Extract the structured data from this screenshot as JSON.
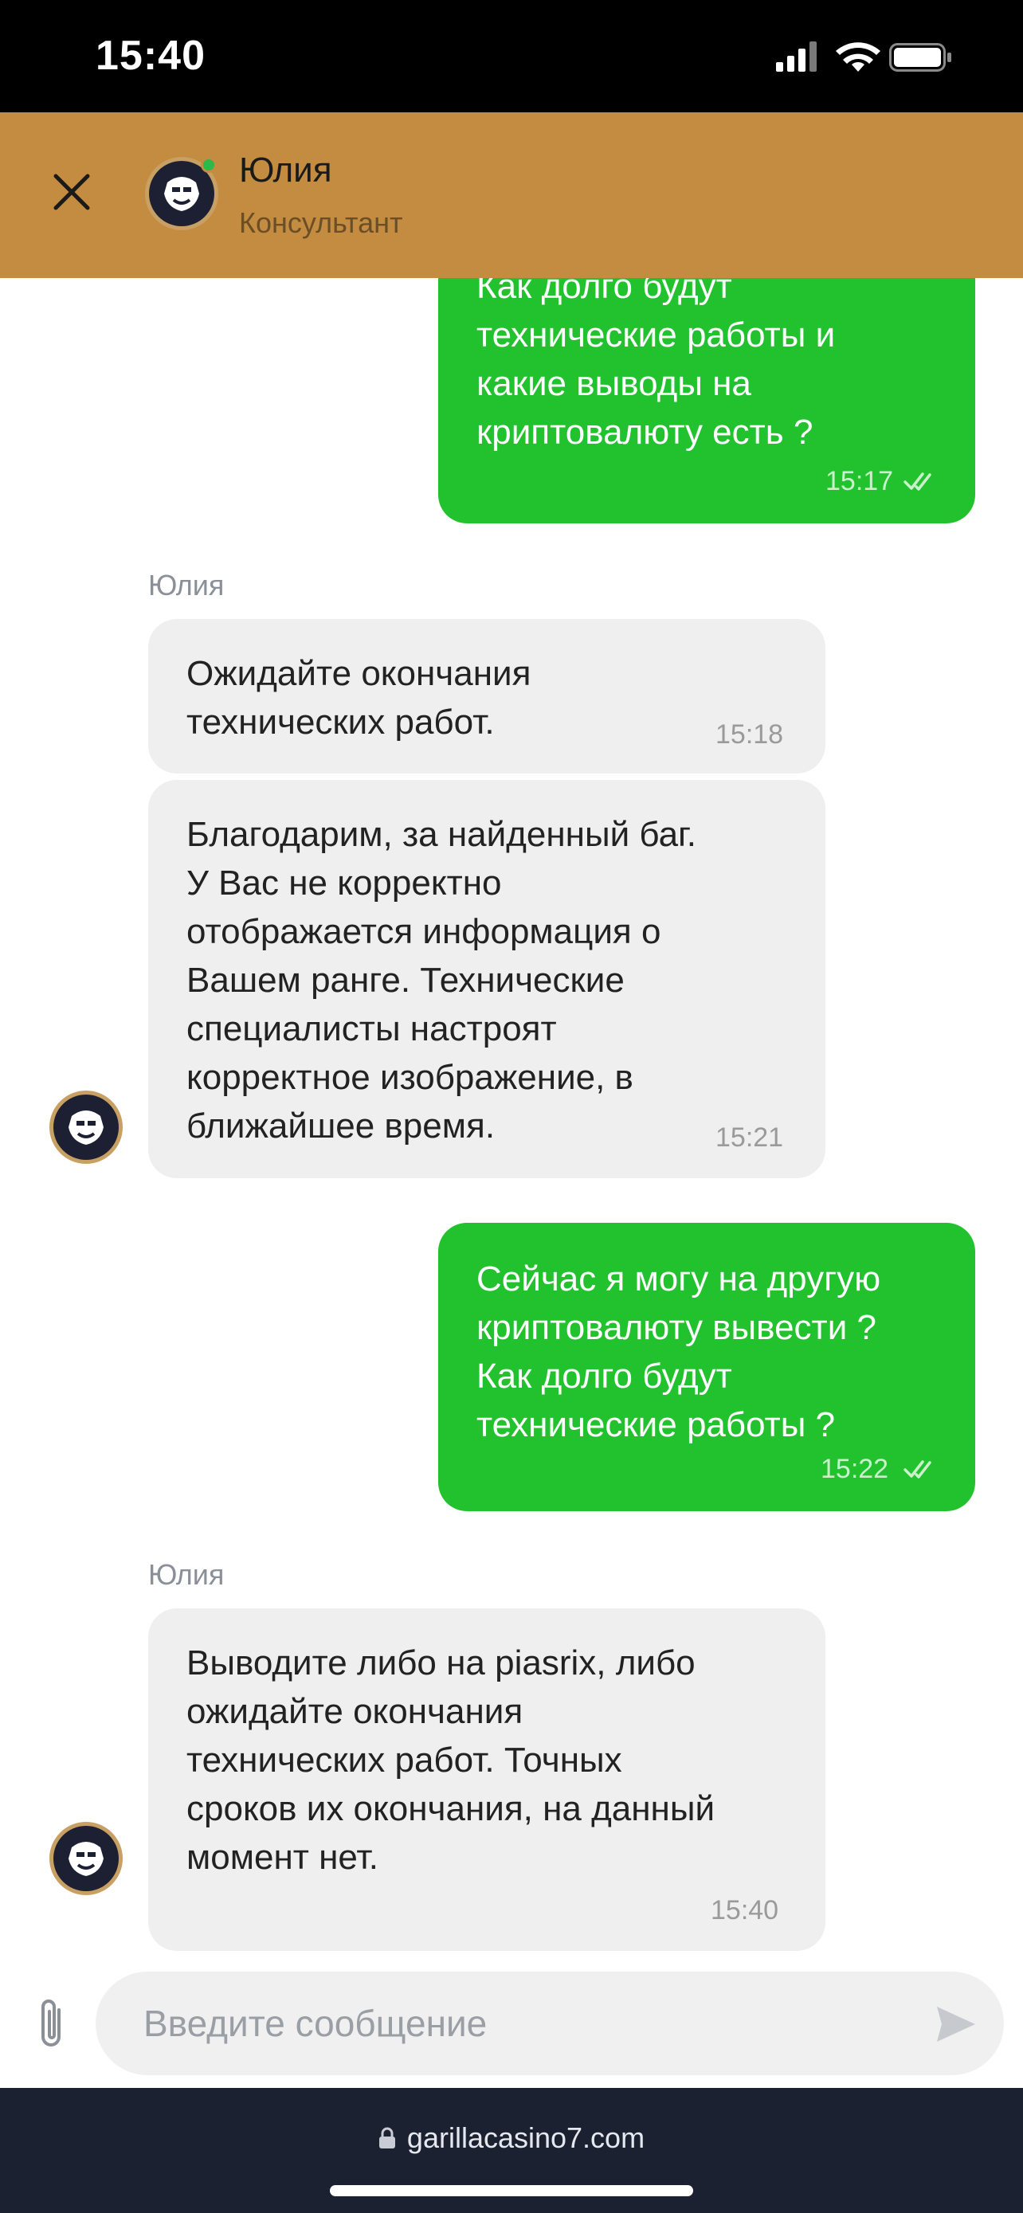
{
  "status_bar": {
    "time": "15:40"
  },
  "header": {
    "name": "Юлия",
    "role": "Консультант",
    "online": true
  },
  "messages": [
    {
      "direction": "out",
      "text": "Как долго будут\nтехнические работы и\nкакие выводы на\nкриптовалюту есть ?",
      "time": "15:17",
      "read": true
    },
    {
      "direction": "in",
      "sender": "Юлия",
      "text": "Ожидайте окончания\nтехнических работ.",
      "time": "15:18"
    },
    {
      "direction": "in",
      "text": "Благодарим, за найденный баг.\nУ Вас не корректно\nотображается информация о\nВашем ранге. Технические\nспециалисты настроят\nкорректное изображение, в\nближайшее время.",
      "time": "15:21"
    },
    {
      "direction": "out",
      "text": "Сейчас я могу на другую\nкриптовалюту вывести ?\nКак долго будут\nтехнические работы ?",
      "time": "15:22",
      "read": true
    },
    {
      "direction": "in",
      "sender": "Юлия",
      "text": "Выводите либо на piasrix, либо\nожидайте окончания\nтехнических работ. Точных\nсроков их окончания, на данный\nмомент нет.",
      "time": "15:40"
    }
  ],
  "composer": {
    "placeholder": "Введите сообщение"
  },
  "browser": {
    "url": "garillacasino7.com"
  },
  "colors": {
    "header_bg": "#c48c40",
    "outgoing_bubble": "#22c12e",
    "incoming_bubble": "#efefef",
    "browser_bar": "#1c2132",
    "online_dot": "#2db84a"
  },
  "icons": {
    "close": "close-icon",
    "avatar": "gorilla-logo-avatar",
    "attach": "paperclip-icon",
    "send": "send-icon",
    "lock": "lock-icon",
    "read_receipt": "double-check-icon"
  }
}
